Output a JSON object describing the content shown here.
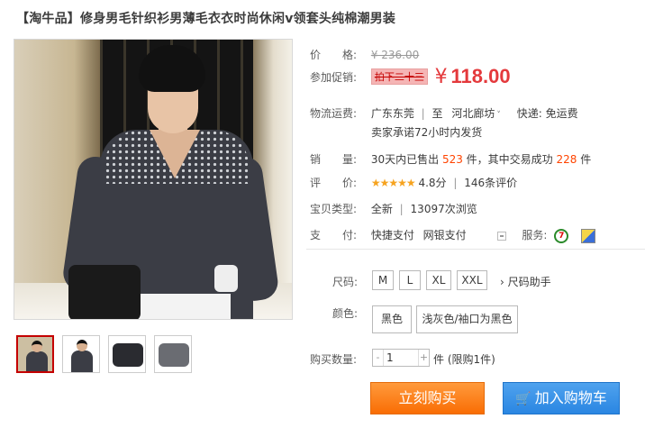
{
  "title": "【淘牛品】修身男毛针织衫男薄毛衣衣时尚休闲v领套头纯棉潮男装",
  "price_section": {
    "price_label": "价　　格:",
    "original_price": "¥ 236.00",
    "promo_label": "参加促销:",
    "promo_tag": "拍下二十三",
    "currency": "¥",
    "promo_price": "118.00"
  },
  "shipping": {
    "label": "物流运费:",
    "from": "广东东莞",
    "to_prefix": "至",
    "to": "河北廊坊",
    "express": "快递: 免运费",
    "promise": "卖家承诺72小时内发货"
  },
  "sales": {
    "label": "销　　量:",
    "prefix": "30天内已售出",
    "sold": "523",
    "middle": "件，其中交易成功",
    "success": "228",
    "suffix": "件"
  },
  "rating": {
    "label": "评　　价:",
    "stars": "★★★★★",
    "score": "4.8分",
    "reviews": "146条评价"
  },
  "condition": {
    "label": "宝贝类型:",
    "value": "全新",
    "views": "13097次浏览"
  },
  "payment": {
    "label": "支　　付:",
    "option1": "快捷支付",
    "option2": "网银支付",
    "service_label": "服务:",
    "service_icon_text": "7"
  },
  "options": {
    "size_label": "尺码:",
    "sizes": [
      "M",
      "L",
      "XL",
      "XXL"
    ],
    "size_guide": "› 尺码助手",
    "color_label": "颜色:",
    "colors": [
      "黑色",
      "浅灰色/袖口为黑色"
    ]
  },
  "quantity": {
    "label": "购买数量:",
    "minus": "-",
    "plus": "+",
    "value": "1",
    "note": "件 (限购1件)"
  },
  "actions": {
    "buy_now": "立刻购买",
    "add_to_cart": "加入购物车"
  },
  "icons": {
    "cart": "cart-icon",
    "service_seven_day": "seven-day-return-icon",
    "service_card": "credit-card-icon"
  },
  "colors": {
    "price_red": "#e4393c",
    "highlight_orange": "#ff4400",
    "buy_orange": "#f96d04",
    "cart_blue": "#2a86e2",
    "star_gold": "#f6a31f"
  }
}
